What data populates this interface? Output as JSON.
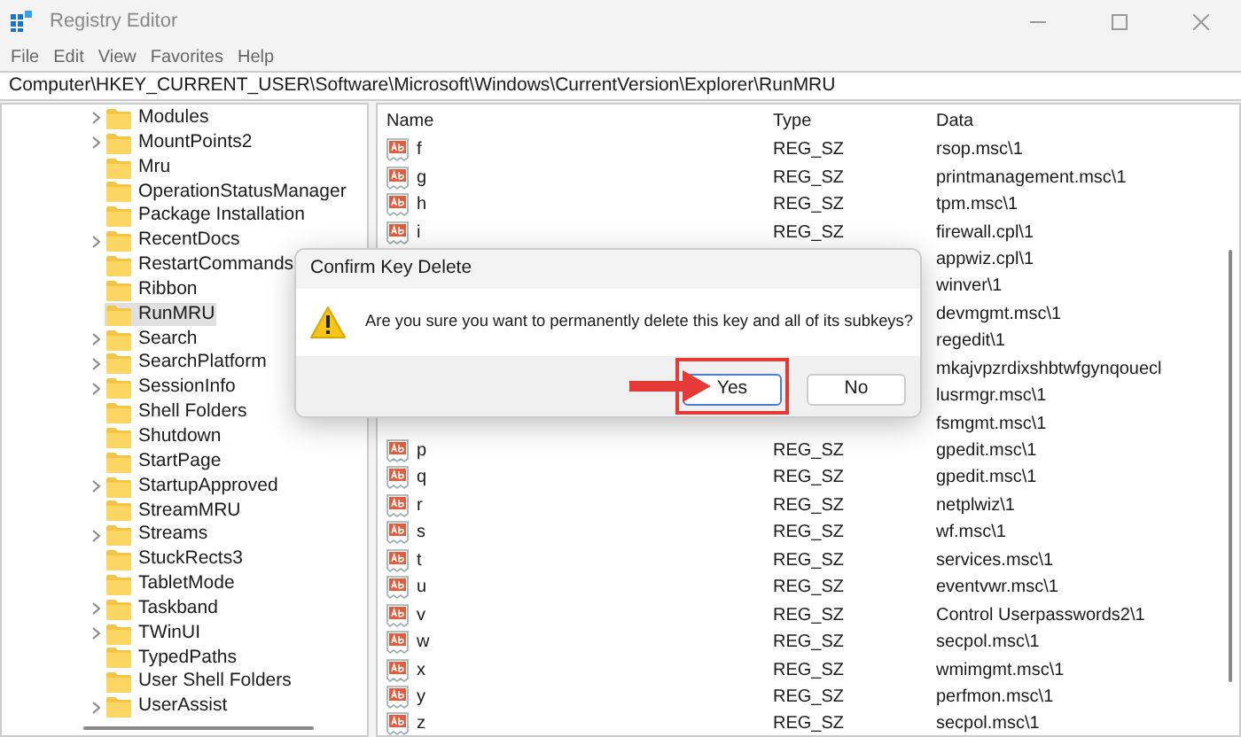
{
  "window": {
    "title": "Registry Editor"
  },
  "menu": [
    "File",
    "Edit",
    "View",
    "Favorites",
    "Help"
  ],
  "address": "Computer\\HKEY_CURRENT_USER\\Software\\Microsoft\\Windows\\CurrentVersion\\Explorer\\RunMRU",
  "tree": [
    {
      "label": "Modules",
      "expandable": true,
      "selected": false
    },
    {
      "label": "MountPoints2",
      "expandable": true,
      "selected": false
    },
    {
      "label": "Mru",
      "expandable": false,
      "selected": false
    },
    {
      "label": "OperationStatusManager",
      "expandable": false,
      "selected": false
    },
    {
      "label": "Package Installation",
      "expandable": false,
      "selected": false
    },
    {
      "label": "RecentDocs",
      "expandable": true,
      "selected": false
    },
    {
      "label": "RestartCommands",
      "expandable": false,
      "selected": false
    },
    {
      "label": "Ribbon",
      "expandable": false,
      "selected": false
    },
    {
      "label": "RunMRU",
      "expandable": false,
      "selected": true
    },
    {
      "label": "Search",
      "expandable": true,
      "selected": false
    },
    {
      "label": "SearchPlatform",
      "expandable": true,
      "selected": false
    },
    {
      "label": "SessionInfo",
      "expandable": true,
      "selected": false
    },
    {
      "label": "Shell Folders",
      "expandable": false,
      "selected": false
    },
    {
      "label": "Shutdown",
      "expandable": false,
      "selected": false
    },
    {
      "label": "StartPage",
      "expandable": false,
      "selected": false
    },
    {
      "label": "StartupApproved",
      "expandable": true,
      "selected": false
    },
    {
      "label": "StreamMRU",
      "expandable": false,
      "selected": false
    },
    {
      "label": "Streams",
      "expandable": true,
      "selected": false
    },
    {
      "label": "StuckRects3",
      "expandable": false,
      "selected": false
    },
    {
      "label": "TabletMode",
      "expandable": false,
      "selected": false
    },
    {
      "label": "Taskband",
      "expandable": true,
      "selected": false
    },
    {
      "label": "TWinUI",
      "expandable": true,
      "selected": false
    },
    {
      "label": "TypedPaths",
      "expandable": false,
      "selected": false
    },
    {
      "label": "User Shell Folders",
      "expandable": false,
      "selected": false
    },
    {
      "label": "UserAssist",
      "expandable": true,
      "selected": false
    }
  ],
  "table": {
    "columns": [
      "Name",
      "Type",
      "Data"
    ],
    "rows": [
      {
        "name": "f",
        "type": "REG_SZ",
        "data": "rsop.msc\\1"
      },
      {
        "name": "g",
        "type": "REG_SZ",
        "data": "printmanagement.msc\\1"
      },
      {
        "name": "h",
        "type": "REG_SZ",
        "data": "tpm.msc\\1"
      },
      {
        "name": "i",
        "type": "REG_SZ",
        "data": "firewall.cpl\\1"
      },
      {
        "data": "appwiz.cpl\\1"
      },
      {
        "data": "winver\\1"
      },
      {
        "data": "devmgmt.msc\\1"
      },
      {
        "data": "regedit\\1"
      },
      {
        "data": "mkajvpzrdixshbtwfgynqouecl"
      },
      {
        "data": "lusrmgr.msc\\1"
      },
      {
        "data": "fsmgmt.msc\\1"
      },
      {
        "name": "p",
        "type": "REG_SZ",
        "data": "gpedit.msc\\1"
      },
      {
        "name": "q",
        "type": "REG_SZ",
        "data": "gpedit.msc\\1"
      },
      {
        "name": "r",
        "type": "REG_SZ",
        "data": "netplwiz\\1"
      },
      {
        "name": "s",
        "type": "REG_SZ",
        "data": "wf.msc\\1"
      },
      {
        "name": "t",
        "type": "REG_SZ",
        "data": "services.msc\\1"
      },
      {
        "name": "u",
        "type": "REG_SZ",
        "data": "eventvwr.msc\\1"
      },
      {
        "name": "v",
        "type": "REG_SZ",
        "data": "Control Userpasswords2\\1"
      },
      {
        "name": "w",
        "type": "REG_SZ",
        "data": "secpol.msc\\1"
      },
      {
        "name": "x",
        "type": "REG_SZ",
        "data": "wmimgmt.msc\\1"
      },
      {
        "name": "y",
        "type": "REG_SZ",
        "data": "perfmon.msc\\1"
      },
      {
        "name": "z",
        "type": "REG_SZ",
        "data": "secpol.msc\\1"
      }
    ]
  },
  "dialog": {
    "title": "Confirm Key Delete",
    "message": "Are you sure you want to permanently delete this key and all of its subkeys?",
    "buttons": [
      {
        "label": "Yes",
        "default": true,
        "highlighted": true
      },
      {
        "label": "No",
        "default": false,
        "highlighted": false
      }
    ]
  }
}
